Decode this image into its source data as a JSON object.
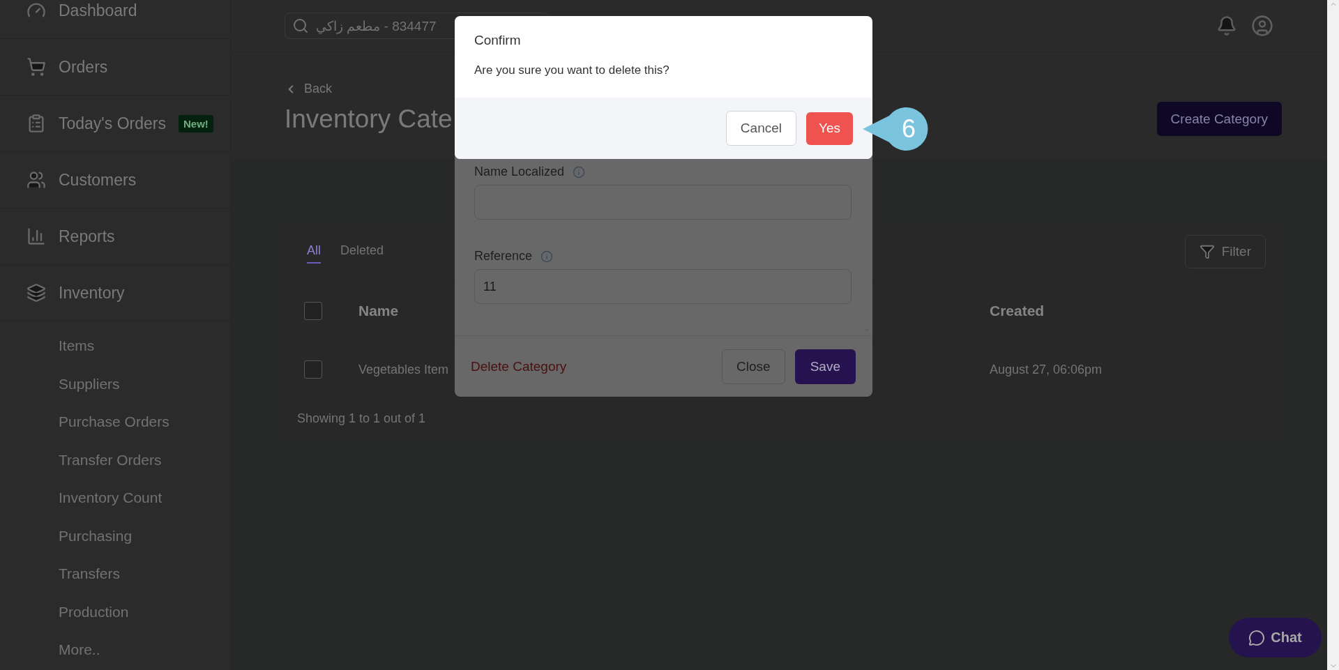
{
  "sidebar": {
    "items": [
      {
        "label": "Dashboard"
      },
      {
        "label": "Orders"
      },
      {
        "label": "Today's Orders",
        "badge": "New!"
      },
      {
        "label": "Customers"
      },
      {
        "label": "Reports"
      },
      {
        "label": "Inventory",
        "children": [
          {
            "label": "Items"
          },
          {
            "label": "Suppliers"
          },
          {
            "label": "Purchase Orders"
          },
          {
            "label": "Transfer Orders"
          },
          {
            "label": "Inventory Count"
          },
          {
            "label": "Purchasing"
          },
          {
            "label": "Transfers"
          },
          {
            "label": "Production"
          },
          {
            "label": "More.."
          }
        ]
      }
    ]
  },
  "header": {
    "search": {
      "value": "834477 - مطعم زاكي"
    }
  },
  "page": {
    "back": "Back",
    "title": "Inventory Cate",
    "create_button": "Create Category"
  },
  "card": {
    "tabs": [
      {
        "label": "All",
        "selected": true
      },
      {
        "label": "Deleted",
        "selected": false
      }
    ],
    "filter": "Filter",
    "columns": [
      "Name",
      "Created"
    ],
    "header_checked": false,
    "rows": [
      {
        "checked": false,
        "name": "Vegetables Item",
        "created": "August 27, 06:06pm"
      }
    ],
    "footer": "Showing 1 to 1 out of 1"
  },
  "edit_modal": {
    "fields": [
      {
        "label": "Name Localized"
      },
      {
        "label": "Reference",
        "value": "11"
      }
    ],
    "delete": "Delete Category",
    "close": "Close",
    "save": "Save"
  },
  "confirm": {
    "title": "Confirm",
    "message": "Are you sure you want to delete this?",
    "cancel": "Cancel",
    "yes": "Yes"
  },
  "step_badge": "6",
  "chat": "Chat"
}
